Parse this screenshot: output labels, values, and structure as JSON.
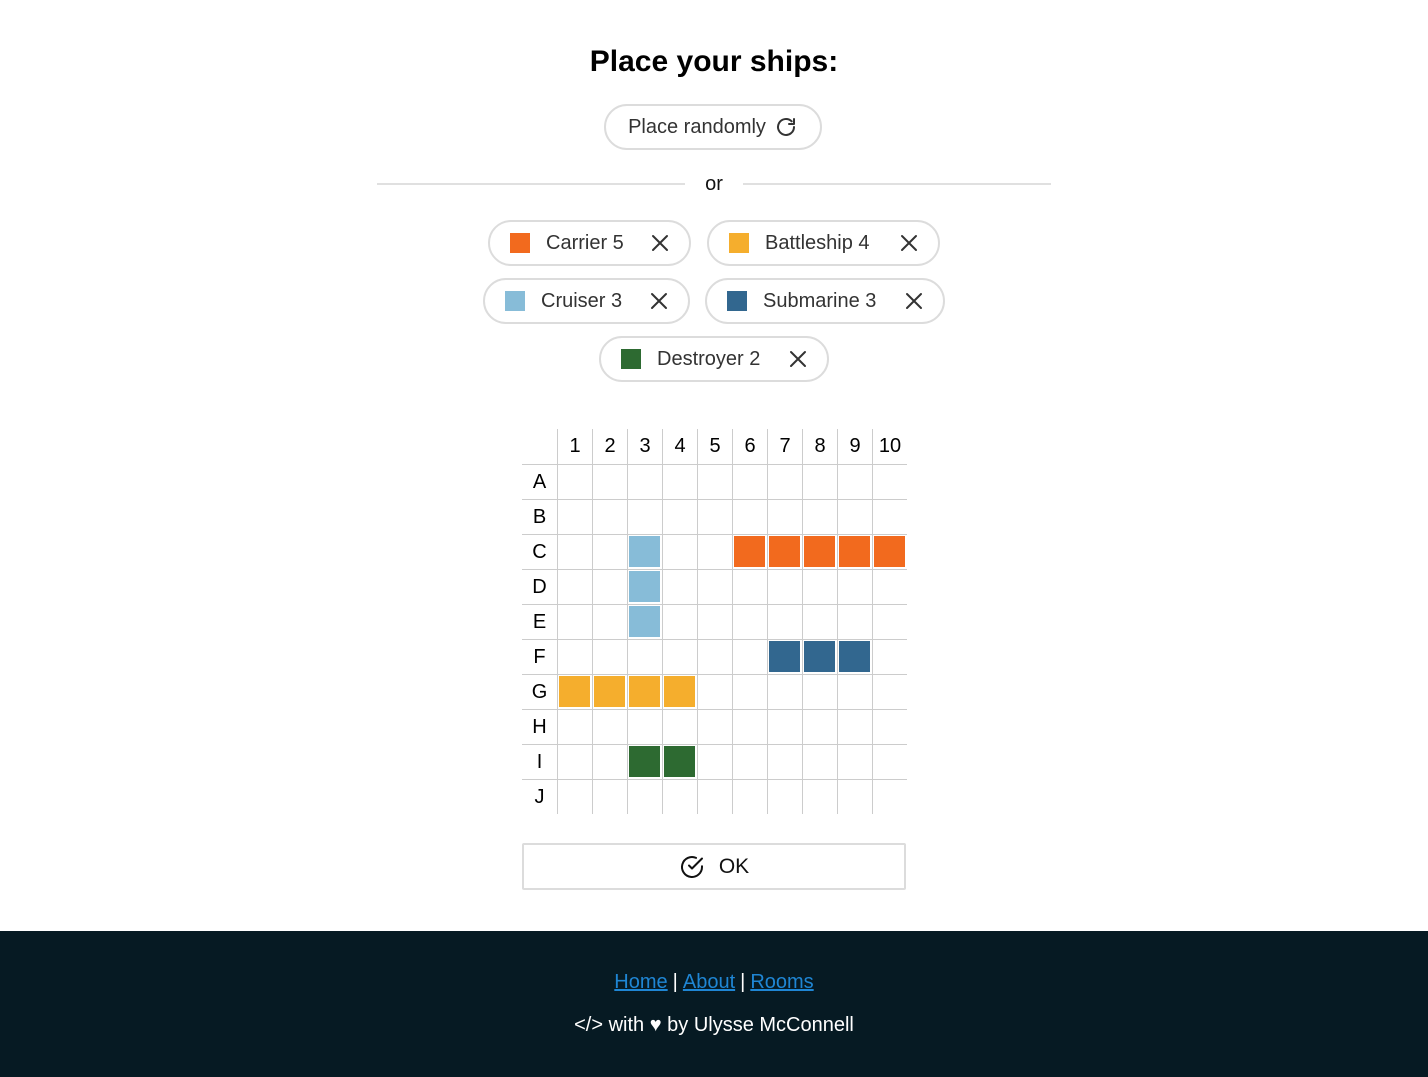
{
  "title": "Place your ships:",
  "random_button": {
    "label": "Place randomly",
    "icon": "refresh-icon"
  },
  "divider_text": "or",
  "ships": [
    {
      "id": "carrier",
      "label": "Carrier 5",
      "color": "#f26a1e",
      "size": 5
    },
    {
      "id": "battleship",
      "label": "Battleship 4",
      "color": "#f5ae2d",
      "size": 4
    },
    {
      "id": "cruiser",
      "label": "Cruiser 3",
      "color": "#87bcd8",
      "size": 3
    },
    {
      "id": "submarine",
      "label": "Submarine 3",
      "color": "#32678f",
      "size": 3
    },
    {
      "id": "destroyer",
      "label": "Destroyer 2",
      "color": "#2d6a31",
      "size": 2
    }
  ],
  "board": {
    "columns": [
      "1",
      "2",
      "3",
      "4",
      "5",
      "6",
      "7",
      "8",
      "9",
      "10"
    ],
    "rows": [
      "A",
      "B",
      "C",
      "D",
      "E",
      "F",
      "G",
      "H",
      "I",
      "J"
    ],
    "placements": [
      {
        "ship": "carrier",
        "cells": [
          "C6",
          "C7",
          "C8",
          "C9",
          "C10"
        ]
      },
      {
        "ship": "battleship",
        "cells": [
          "G1",
          "G2",
          "G3",
          "G4"
        ]
      },
      {
        "ship": "cruiser",
        "cells": [
          "C3",
          "D3",
          "E3"
        ]
      },
      {
        "ship": "submarine",
        "cells": [
          "F7",
          "F8",
          "F9"
        ]
      },
      {
        "ship": "destroyer",
        "cells": [
          "I3",
          "I4"
        ]
      }
    ],
    "grid_color": "#cccccc"
  },
  "ok_button": {
    "label": "OK",
    "icon": "check-circle-icon"
  },
  "footer": {
    "links": [
      "Home",
      "About",
      "Rooms"
    ],
    "separator": "|",
    "link_color": "#1f86d4",
    "credit": "</> with ♥ by Ulysse McConnell",
    "background": "#061a23"
  }
}
